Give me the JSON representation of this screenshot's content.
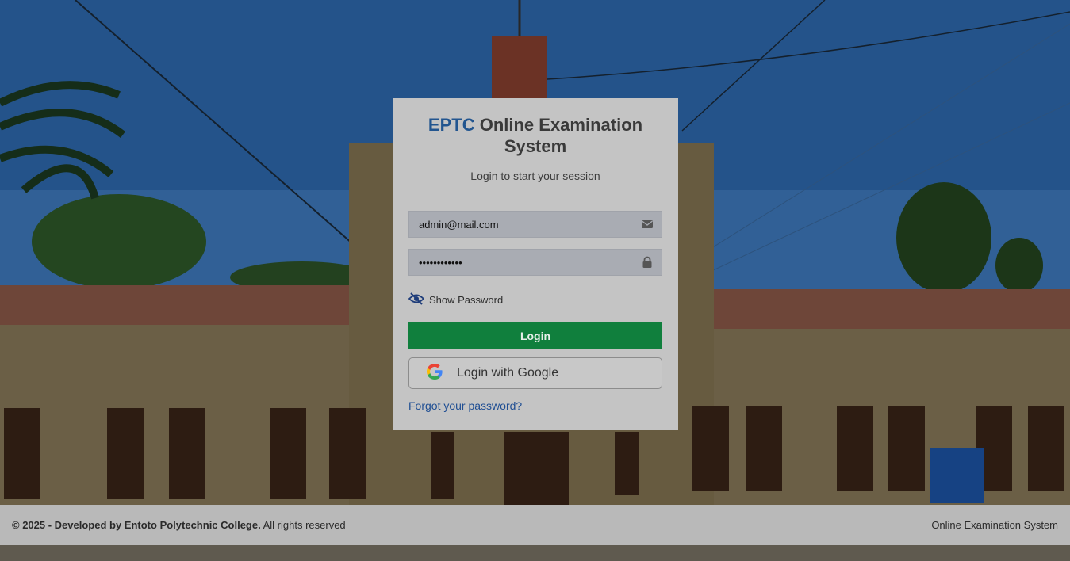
{
  "login": {
    "brand": "EPTC",
    "title_rest": " Online Examination System",
    "subtitle": "Login to start your session",
    "email_value": "admin@mail.com",
    "password_value": "••••••••••••",
    "show_password_label": "Show Password",
    "login_button": "Login",
    "google_button": "Login with Google",
    "forgot_link": "Forgot your password?"
  },
  "footer": {
    "copyright_bold": "© 2025 - Developed by Entoto Polytechnic College.",
    "copyright_rest": " All rights reserved",
    "app_name": "Online Examination System"
  },
  "colors": {
    "brand": "#22558f",
    "login_button": "#107f3d",
    "link": "#1f4e93"
  },
  "icons": {
    "email": "envelope-icon",
    "password": "lock-icon",
    "show_password": "eye-slash-icon",
    "google": "google-logo-icon"
  }
}
